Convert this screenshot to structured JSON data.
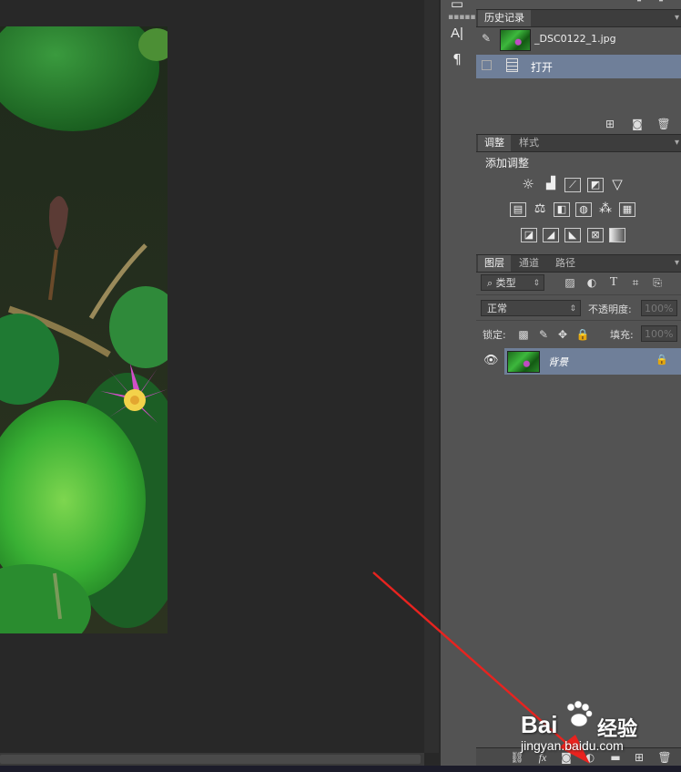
{
  "history_panel": {
    "tab_label": "历史记录",
    "snapshot_name": "_DSC0122_1.jpg",
    "items": [
      {
        "label": "打开"
      }
    ]
  },
  "adjustments_panel": {
    "tabs": [
      "调整",
      "样式"
    ],
    "title": "添加调整"
  },
  "layers_panel": {
    "tabs": [
      "图层",
      "通道",
      "路径"
    ],
    "filter_label": "类型",
    "blend_mode": "正常",
    "opacity_label": "不透明度:",
    "opacity_value": "100%",
    "lock_label": "锁定:",
    "fill_label": "填充:",
    "fill_value": "100%",
    "layers": [
      {
        "name": "背景"
      }
    ]
  },
  "watermark": {
    "logo": "Bai",
    "logo_suffix": "经验",
    "url": "jingyan.baidu.com"
  },
  "annotation": {
    "arrow_color": "#e8231f"
  },
  "colors": {
    "panel_bg": "#535353",
    "selection": "#6f7f99",
    "canvas_bg": "#282828"
  }
}
